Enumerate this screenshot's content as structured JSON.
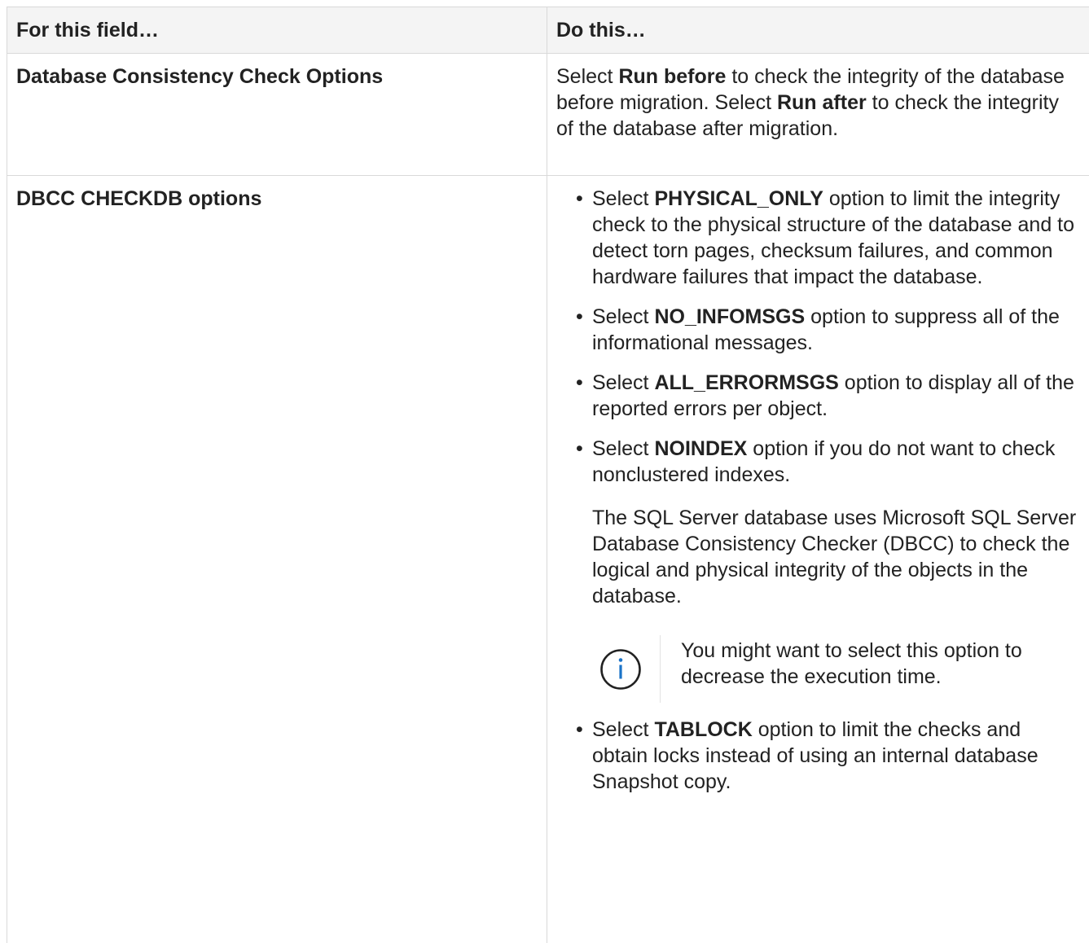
{
  "table": {
    "headers": [
      "For this field…",
      "Do this…"
    ],
    "rows": [
      {
        "field": "Database Consistency Check Options",
        "description": {
          "t1": "Select ",
          "b1": "Run before",
          "t2": " to check the integrity of the database before migration. Select ",
          "b2": "Run after",
          "t3": " to check the integrity of the database after migration."
        }
      },
      {
        "field": "DBCC CHECKDB options",
        "options": [
          {
            "prefix": "Select ",
            "keyword": "PHYSICAL_ONLY",
            "suffix": " option to limit the integrity check to the physical structure of the database and to detect torn pages, checksum failures, and common hardware failures that impact the database."
          },
          {
            "prefix": "Select ",
            "keyword": "NO_INFOMSGS",
            "suffix": " option to suppress all of the informational messages."
          },
          {
            "prefix": "Select ",
            "keyword": "ALL_ERRORMSGS",
            "suffix": " option to display all of the reported errors per object."
          },
          {
            "prefix": "Select ",
            "keyword": "NOINDEX",
            "suffix": " option if you do not want to check nonclustered indexes."
          },
          {
            "prefix": "Select ",
            "keyword": "TABLOCK",
            "suffix": " option to limit the checks and obtain locks instead of using an internal database Snapshot copy."
          }
        ],
        "note_paragraph": "The SQL Server database uses Microsoft SQL Server Database Consistency Checker (DBCC) to check the logical and physical integrity of the objects in the database.",
        "admonition": {
          "icon": "info-icon",
          "text": "You might want to select this option to decrease the execution time."
        }
      }
    ]
  },
  "colors": {
    "border": "#d9d9d9",
    "header_bg": "#f4f4f4",
    "text": "#222222",
    "info_icon": "#1a73c8"
  }
}
